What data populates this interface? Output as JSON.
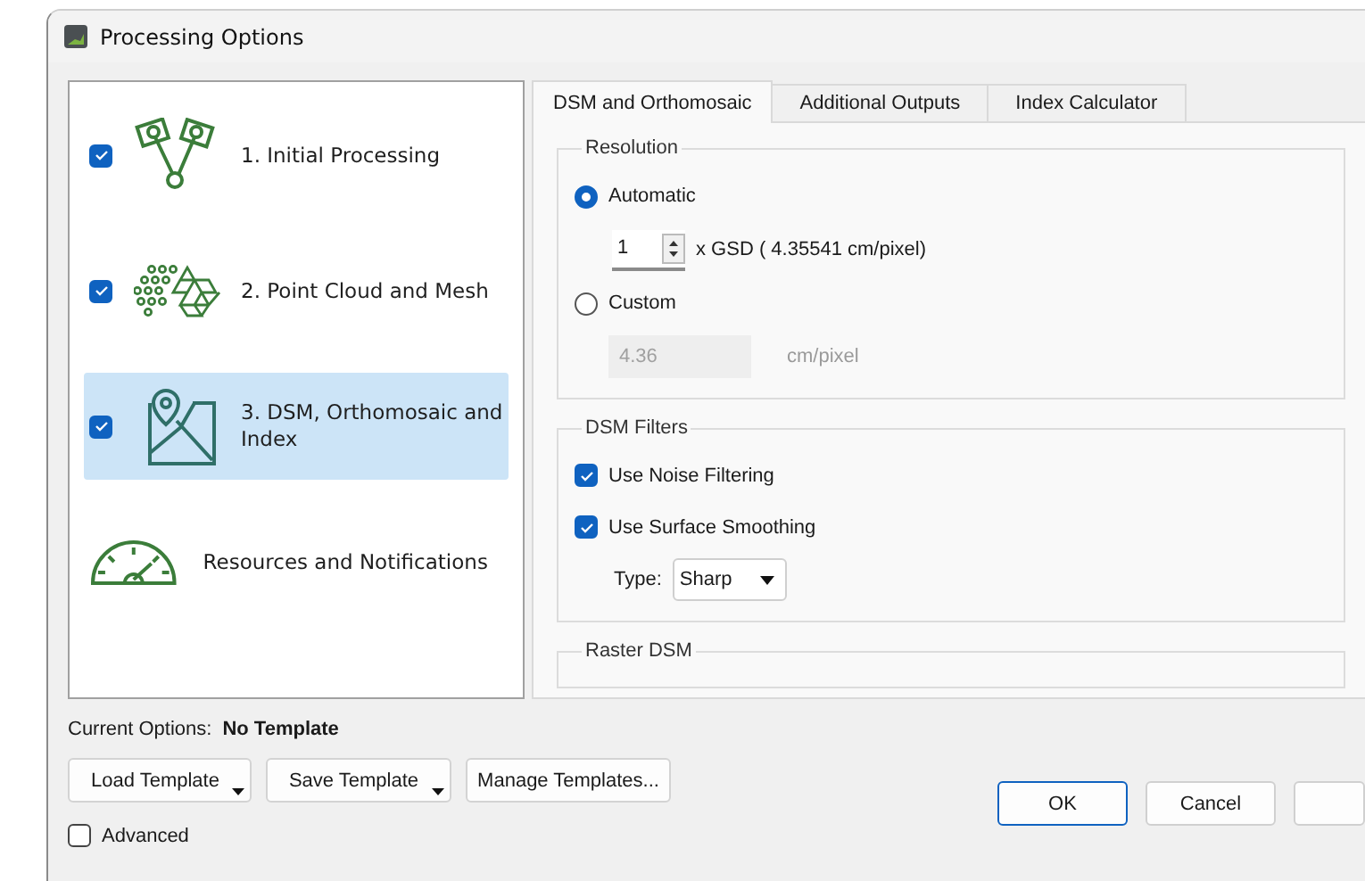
{
  "window": {
    "title": "Processing Options"
  },
  "steps": [
    {
      "kind": "step",
      "label": "1. Initial Processing",
      "checked": true,
      "selected": false
    },
    {
      "kind": "step",
      "label": "2. Point Cloud and Mesh",
      "checked": true,
      "selected": false
    },
    {
      "kind": "step",
      "label": "3. DSM, Orthomosaic and Index",
      "checked": true,
      "selected": true
    },
    {
      "kind": "plain",
      "label": "Resources and Notifications",
      "selected": false
    }
  ],
  "tabs": [
    {
      "label": "DSM and Orthomosaic",
      "selected": true
    },
    {
      "label": "Additional Outputs",
      "selected": false
    },
    {
      "label": "Index Calculator",
      "selected": false
    }
  ],
  "resolution": {
    "title": "Resolution",
    "automatic": {
      "label": "Automatic",
      "selected": true,
      "multiplier": "1",
      "suffix": "x GSD ( 4.35541 cm/pixel)"
    },
    "custom": {
      "label": "Custom",
      "selected": false,
      "value": "4.36",
      "unit": "cm/pixel",
      "disabled": true
    }
  },
  "dsm_filters": {
    "title": "DSM Filters",
    "options": [
      {
        "label": "Use Noise Filtering",
        "checked": true
      },
      {
        "label": "Use Surface Smoothing",
        "checked": true
      }
    ],
    "type_label": "Type:",
    "type_value": "Sharp"
  },
  "raster_dsm": {
    "title": "Raster DSM"
  },
  "current_options": {
    "label": "Current Options:",
    "value": "No Template"
  },
  "template_buttons": [
    {
      "label": "Load Template",
      "menu": true
    },
    {
      "label": "Save Template",
      "menu": true
    },
    {
      "label": "Manage Templates...",
      "menu": false
    }
  ],
  "advanced": {
    "label": "Advanced",
    "checked": false
  },
  "dialog_buttons": [
    {
      "label": "OK",
      "default": true
    },
    {
      "label": "Cancel",
      "default": false
    }
  ]
}
